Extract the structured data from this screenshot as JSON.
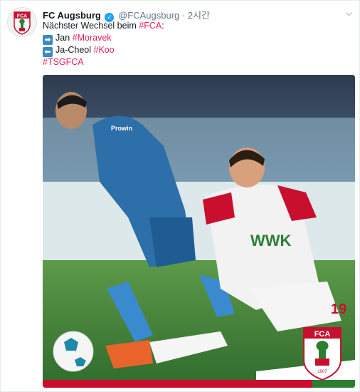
{
  "account": {
    "name": "FC Augsburg",
    "handle": "@FCAugsburg",
    "separator": "·",
    "time": "2시간"
  },
  "avatar_text": "FCA",
  "tweet": {
    "line1": {
      "text": "Nächster Wechsel beim ",
      "tag": "#FCA",
      "suffix": ":"
    },
    "line2": {
      "arrow": "➡",
      "text": "Jan ",
      "tag": "#Moravek"
    },
    "line3": {
      "arrow": "⬅",
      "text": "Ja-Cheol ",
      "tag": "#Koo"
    },
    "line4": {
      "tag": "#TSGFCA"
    }
  },
  "media": {
    "player_left_sponsor": "Prowin",
    "player_right_sponsor": "WWK",
    "player_right_number": "19",
    "crest_text": "FCA",
    "crest_year": "1907"
  },
  "colors": {
    "link": "#e0245e",
    "verified": "#1da1f2",
    "text": "#14171a",
    "muted": "#657786"
  }
}
